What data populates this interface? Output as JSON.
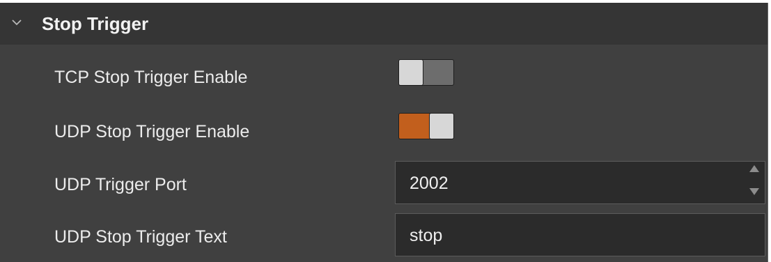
{
  "section": {
    "title": "Stop Trigger",
    "chevron_icon": "chevron-down-icon"
  },
  "rows": {
    "tcp_stop_trigger_enable": {
      "label": "TCP Stop Trigger Enable",
      "enabled": false
    },
    "udp_stop_trigger_enable": {
      "label": "UDP Stop Trigger Enable",
      "enabled": true
    },
    "udp_trigger_port": {
      "label": "UDP Trigger Port",
      "value": "2002"
    },
    "udp_stop_trigger_text": {
      "label": "UDP Stop Trigger Text",
      "value": "stop"
    }
  },
  "colors": {
    "panel_bg": "#404040",
    "header_bg": "#353535",
    "toggle_on": "#c25f1d",
    "toggle_off": "#6d6d6d",
    "field_bg": "#2b2b2b"
  }
}
